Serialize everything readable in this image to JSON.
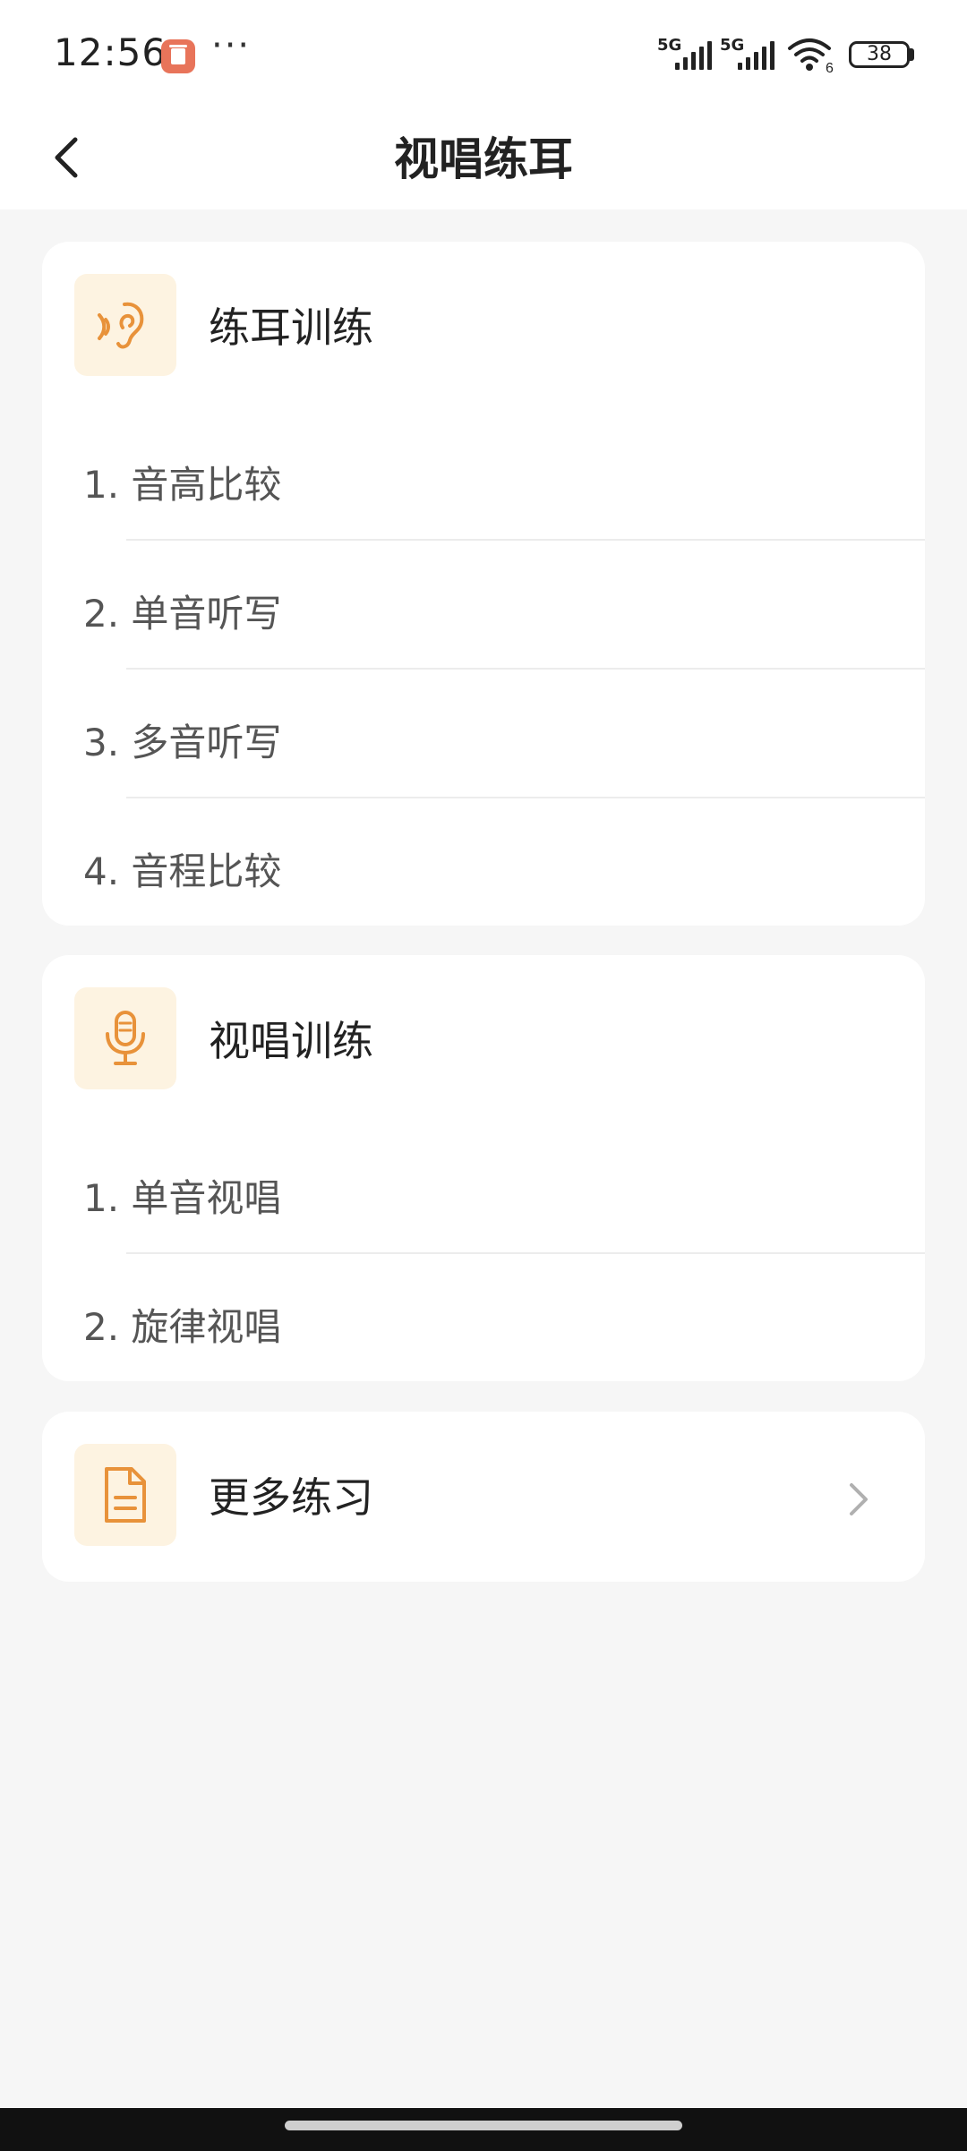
{
  "status_bar": {
    "time": "12:56",
    "more": "···",
    "sig1": "5G",
    "sig2": "5G",
    "wifi_sub": "6",
    "battery": "38"
  },
  "header": {
    "title": "视唱练耳"
  },
  "ear_card": {
    "title": "练耳训练",
    "items": [
      {
        "label": "1. 音高比较"
      },
      {
        "label": "2. 单音听写"
      },
      {
        "label": "3. 多音听写"
      },
      {
        "label": "4. 音程比较"
      }
    ]
  },
  "sing_card": {
    "title": "视唱训练",
    "items": [
      {
        "label": "1. 单音视唱"
      },
      {
        "label": "2. 旋律视唱"
      }
    ]
  },
  "more_card": {
    "title": "更多练习"
  },
  "colors": {
    "accent": "#e8923a",
    "icon_bg": "#fdf3e1",
    "page_bg": "#f6f6f6"
  },
  "icons": {
    "ear": "ear-icon",
    "mic": "microphone-icon",
    "doc": "document-icon",
    "back": "back-arrow-icon",
    "chevron": "chevron-right-icon"
  }
}
